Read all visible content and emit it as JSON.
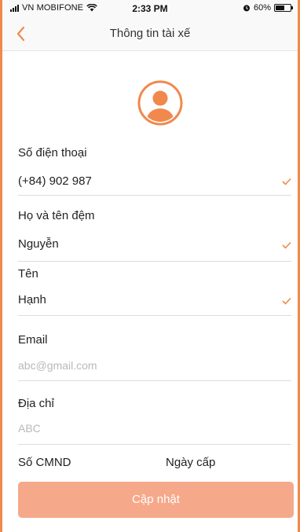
{
  "status_bar": {
    "carrier": "VN MOBIFONE",
    "time": "2:33 PM",
    "battery": "60%",
    "battery_level": 0.6
  },
  "nav": {
    "title": "Thông tin tài xế",
    "back_icon": "chevron-left-icon"
  },
  "avatar": {
    "icon": "user-avatar-icon"
  },
  "form": {
    "phone": {
      "label": "Số điện thoại",
      "value": "(+84) 902 987"
    },
    "middle_name": {
      "label": "Họ và tên đệm",
      "value": "Nguyễn"
    },
    "first_name": {
      "label": "Tên",
      "value": "Hạnh"
    },
    "email": {
      "label": "Email",
      "placeholder": "abc@gmail.com"
    },
    "address": {
      "label": "Địa chỉ",
      "placeholder": "ABC"
    },
    "id_card": {
      "label": "Số CMND"
    },
    "issue_date": {
      "label": "Ngày cấp"
    }
  },
  "update_button": {
    "label": "Cập nhật"
  },
  "colors": {
    "accent": "#f0894b",
    "button": "#f6a88a",
    "check": "#f0894b"
  }
}
